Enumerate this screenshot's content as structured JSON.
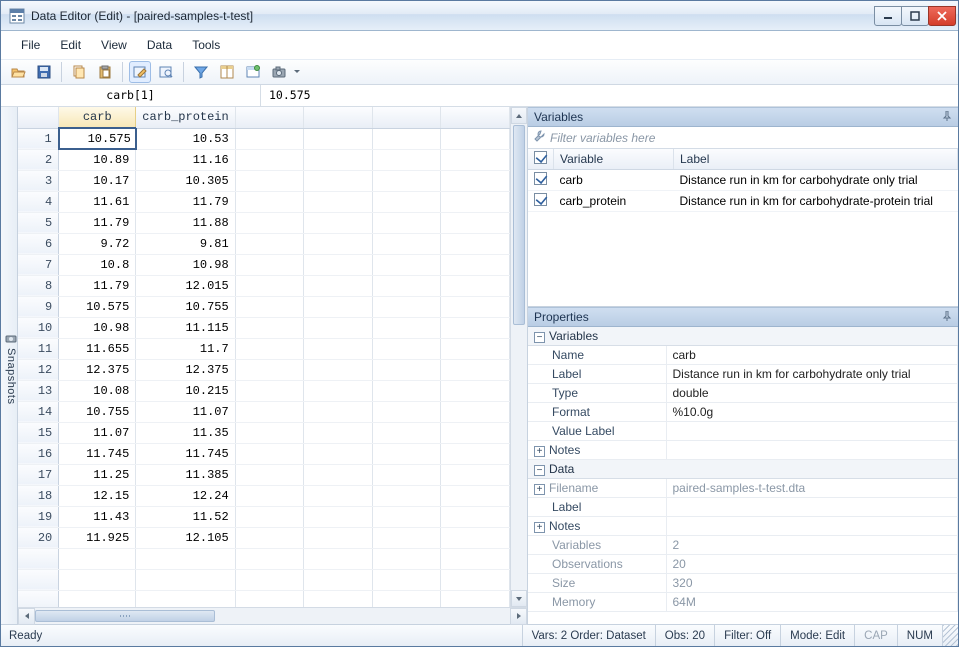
{
  "window": {
    "title": "Data Editor (Edit) - [paired-samples-t-test]"
  },
  "menu": {
    "items": [
      "File",
      "Edit",
      "View",
      "Data",
      "Tools"
    ]
  },
  "toolbar_icons": [
    "open",
    "save",
    "copy",
    "paste",
    "browse-edit",
    "browse-view",
    "filter",
    "vars",
    "props",
    "snapshot"
  ],
  "snapshots_label": "Snapshots",
  "address": {
    "ref": "carb[1]",
    "value": "10.575"
  },
  "grid": {
    "columns": [
      "carb",
      "carb_protein"
    ],
    "rows": [
      {
        "n": 1,
        "carb": "10.575",
        "carb_protein": "10.53"
      },
      {
        "n": 2,
        "carb": "10.89",
        "carb_protein": "11.16"
      },
      {
        "n": 3,
        "carb": "10.17",
        "carb_protein": "10.305"
      },
      {
        "n": 4,
        "carb": "11.61",
        "carb_protein": "11.79"
      },
      {
        "n": 5,
        "carb": "11.79",
        "carb_protein": "11.88"
      },
      {
        "n": 6,
        "carb": "9.72",
        "carb_protein": "9.81"
      },
      {
        "n": 7,
        "carb": "10.8",
        "carb_protein": "10.98"
      },
      {
        "n": 8,
        "carb": "11.79",
        "carb_protein": "12.015"
      },
      {
        "n": 9,
        "carb": "10.575",
        "carb_protein": "10.755"
      },
      {
        "n": 10,
        "carb": "10.98",
        "carb_protein": "11.115"
      },
      {
        "n": 11,
        "carb": "11.655",
        "carb_protein": "11.7"
      },
      {
        "n": 12,
        "carb": "12.375",
        "carb_protein": "12.375"
      },
      {
        "n": 13,
        "carb": "10.08",
        "carb_protein": "10.215"
      },
      {
        "n": 14,
        "carb": "10.755",
        "carb_protein": "11.07"
      },
      {
        "n": 15,
        "carb": "11.07",
        "carb_protein": "11.35"
      },
      {
        "n": 16,
        "carb": "11.745",
        "carb_protein": "11.745"
      },
      {
        "n": 17,
        "carb": "11.25",
        "carb_protein": "11.385"
      },
      {
        "n": 18,
        "carb": "12.15",
        "carb_protein": "12.24"
      },
      {
        "n": 19,
        "carb": "11.43",
        "carb_protein": "11.52"
      },
      {
        "n": 20,
        "carb": "11.925",
        "carb_protein": "12.105"
      }
    ],
    "selected": {
      "row": 1,
      "col": "carb"
    }
  },
  "variables_pane": {
    "title": "Variables",
    "filter_placeholder": "Filter variables here",
    "headers": {
      "var": "Variable",
      "label": "Label"
    },
    "rows": [
      {
        "name": "carb",
        "label": "Distance run in km for carbohydrate only trial",
        "checked": true
      },
      {
        "name": "carb_protein",
        "label": "Distance run in km for carbohydrate-protein trial",
        "checked": true
      }
    ]
  },
  "properties_pane": {
    "title": "Properties",
    "groups": {
      "variables": {
        "title": "Variables",
        "rows": [
          {
            "k": "Name",
            "v": "carb"
          },
          {
            "k": "Label",
            "v": "Distance run in km for carbohydrate only trial"
          },
          {
            "k": "Type",
            "v": "double"
          },
          {
            "k": "Format",
            "v": "%10.0g"
          },
          {
            "k": "Value Label",
            "v": ""
          }
        ],
        "notes_label": "Notes"
      },
      "data": {
        "title": "Data",
        "rows": [
          {
            "k": "Filename",
            "v": "paired-samples-t-test.dta",
            "expand": true,
            "dim": true
          },
          {
            "k": "Label",
            "v": ""
          },
          {
            "k": "Notes",
            "v": "",
            "expand": true
          }
        ],
        "summary": [
          {
            "k": "Variables",
            "v": "2"
          },
          {
            "k": "Observations",
            "v": "20"
          },
          {
            "k": "Size",
            "v": "320"
          },
          {
            "k": "Memory",
            "v": "64M"
          }
        ]
      }
    }
  },
  "status": {
    "ready": "Ready",
    "vars": "Vars: 2  Order: Dataset",
    "obs": "Obs: 20",
    "filter": "Filter: Off",
    "mode": "Mode: Edit",
    "cap": "CAP",
    "num": "NUM"
  }
}
